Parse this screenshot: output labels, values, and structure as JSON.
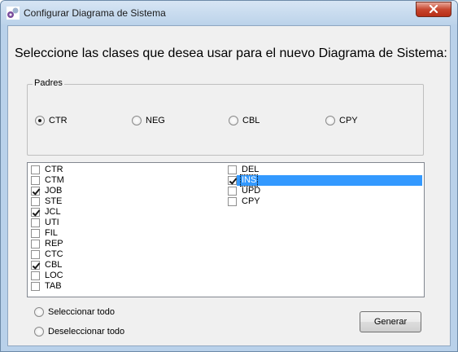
{
  "window": {
    "title": "Configurar Diagrama de Sistema",
    "icon": "app-icon",
    "close_icon": "close-icon"
  },
  "heading": "Seleccione las clases que desea usar para el nuevo Diagrama de Sistema:",
  "padres": {
    "label": "Padres",
    "options": [
      {
        "label": "CTR",
        "selected": true
      },
      {
        "label": "NEG",
        "selected": false
      },
      {
        "label": "CBL",
        "selected": false
      },
      {
        "label": "CPY",
        "selected": false
      }
    ]
  },
  "classes": {
    "column1": [
      {
        "label": "CTR",
        "checked": false
      },
      {
        "label": "CTM",
        "checked": false
      },
      {
        "label": "JOB",
        "checked": true
      },
      {
        "label": "STE",
        "checked": false
      },
      {
        "label": "JCL",
        "checked": true
      },
      {
        "label": "UTI",
        "checked": false
      },
      {
        "label": "FIL",
        "checked": false
      },
      {
        "label": "REP",
        "checked": false
      },
      {
        "label": "CTC",
        "checked": false
      },
      {
        "label": "CBL",
        "checked": true
      },
      {
        "label": "LOC",
        "checked": false
      },
      {
        "label": "TAB",
        "checked": false
      }
    ],
    "column2": [
      {
        "label": "DEL",
        "checked": false
      },
      {
        "label": "INS",
        "checked": true,
        "selected": true
      },
      {
        "label": "UPD",
        "checked": false
      },
      {
        "label": "CPY",
        "checked": false
      }
    ]
  },
  "selection": {
    "select_all": "Seleccionar todo",
    "deselect_all": "Deseleccionar todo"
  },
  "generate_button": "Generar",
  "colors": {
    "selection": "#3399ff",
    "close_button": "#c7472f",
    "frame": "#b9d1ea"
  }
}
